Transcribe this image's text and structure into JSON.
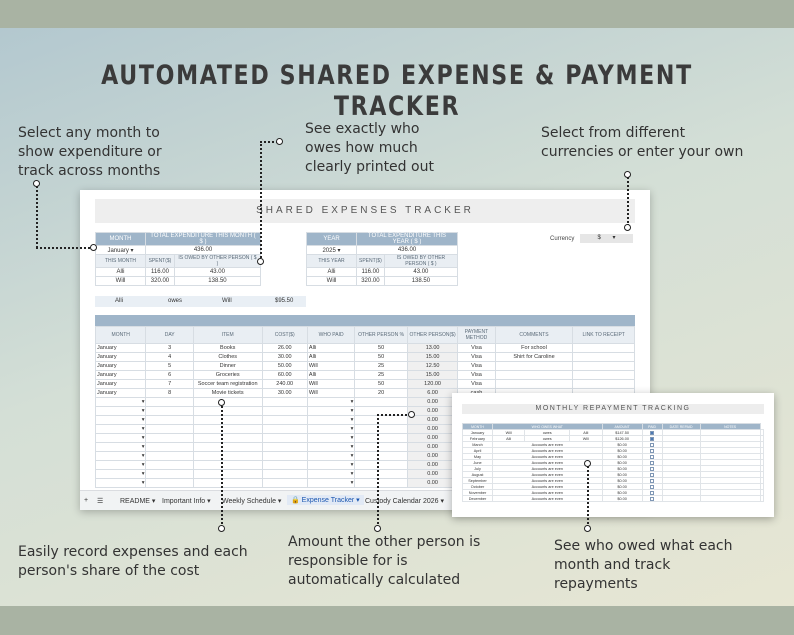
{
  "headline": "AUTOMATED SHARED EXPENSE & PAYMENT TRACKER",
  "callouts": {
    "month": "Select any month to\nshow expenditure or\ntrack across months",
    "owes": "See exactly who\nowes how much\nclearly printed out",
    "currency": "Select from different\ncurrencies or enter your own",
    "record": "Easily record expenses and each\nperson's share of the cost",
    "amount": "Amount the other person is\nresponsible for is\nautomatically calculated",
    "repay": "See who owed what each\nmonth and track\nrepayments"
  },
  "sheet": {
    "title": "SHARED EXPENSES TRACKER",
    "month_table": {
      "h1": "MONTH",
      "h2": "TOTAL EXPENDITURE THIS MONTH ( $ )",
      "month": "January",
      "total": "436.00",
      "s1": "THIS MONTH",
      "s2": "SPENT($)",
      "s3": "IS OWED BY OTHER PERSON ( $ )",
      "rows": [
        [
          "Alli",
          "116.00",
          "43.00"
        ],
        [
          "Will",
          "320.00",
          "138.50"
        ]
      ]
    },
    "year_table": {
      "h1": "YEAR",
      "h2": "TOTAL EXPENDITURE THIS YEAR ( $ )",
      "year": "2025",
      "total": "436.00",
      "s1": "THIS YEAR",
      "s2": "SPENT($)",
      "s3": "IS OWED BY OTHER PERSON ( $ )",
      "rows": [
        [
          "Alli",
          "116.00",
          "43.00"
        ],
        [
          "Will",
          "320.00",
          "138.50"
        ]
      ]
    },
    "currency_label": "Currency",
    "currency_value": "$",
    "owes": {
      "from": "Alli",
      "verb": "owes",
      "to": "Will",
      "amount": "$95.50"
    },
    "columns": [
      "MONTH",
      "DAY",
      "ITEM",
      "COST($)",
      "WHO PAID",
      "OTHER PERSON %",
      "OTHER PERSON($)",
      "PAYMENT METHOD",
      "COMMENTS",
      "LINK TO RECEIPT"
    ],
    "rows": [
      [
        "January",
        "3",
        "Books",
        "26.00",
        "Alli",
        "50",
        "13.00",
        "Visa",
        "For school",
        ""
      ],
      [
        "January",
        "4",
        "Clothes",
        "30.00",
        "Alli",
        "50",
        "15.00",
        "Visa",
        "Shirt for Caroline",
        ""
      ],
      [
        "January",
        "5",
        "Dinner",
        "50.00",
        "Will",
        "25",
        "12.50",
        "Visa",
        "",
        ""
      ],
      [
        "January",
        "6",
        "Groceries",
        "60.00",
        "Alli",
        "25",
        "15.00",
        "Visa",
        "",
        ""
      ],
      [
        "January",
        "7",
        "Soccer team registration",
        "240.00",
        "Will",
        "50",
        "120.00",
        "Visa",
        "",
        ""
      ],
      [
        "January",
        "8",
        "Movie tickets",
        "30.00",
        "Will",
        "20",
        "6.00",
        "cash",
        "",
        ""
      ]
    ],
    "empty_amount": "0.00",
    "tabs": [
      "README",
      "Important Info",
      "Weekly Schedule",
      "Expense Tracker",
      "Custody Calendar 2026"
    ]
  },
  "repayment": {
    "title": "MONTHLY REPAYMENT TRACKING",
    "columns": [
      "MONTH",
      "WHO OWES WHAT",
      "AMOUNT",
      "PAID",
      "DATE REPAID",
      "NOTES"
    ],
    "rows": [
      [
        "January",
        "Will",
        "owes",
        "Alli",
        "$147.50",
        true
      ],
      [
        "February",
        "Alli",
        "owes",
        "Will",
        "$126.00",
        true
      ],
      [
        "March",
        "Accounts are even",
        "",
        "",
        "$0.00",
        false
      ],
      [
        "April",
        "Accounts are even",
        "",
        "",
        "$0.00",
        false
      ],
      [
        "May",
        "Accounts are even",
        "",
        "",
        "$0.00",
        false
      ],
      [
        "June",
        "Accounts are even",
        "",
        "",
        "$0.00",
        false
      ],
      [
        "July",
        "Accounts are even",
        "",
        "",
        "$0.00",
        false
      ],
      [
        "August",
        "Accounts are even",
        "",
        "",
        "$0.00",
        false
      ],
      [
        "September",
        "Accounts are even",
        "",
        "",
        "$0.00",
        false
      ],
      [
        "October",
        "Accounts are even",
        "",
        "",
        "$0.00",
        false
      ],
      [
        "November",
        "Accounts are even",
        "",
        "",
        "$0.00",
        false
      ],
      [
        "December",
        "Accounts are even",
        "",
        "",
        "$0.00",
        false
      ]
    ]
  }
}
